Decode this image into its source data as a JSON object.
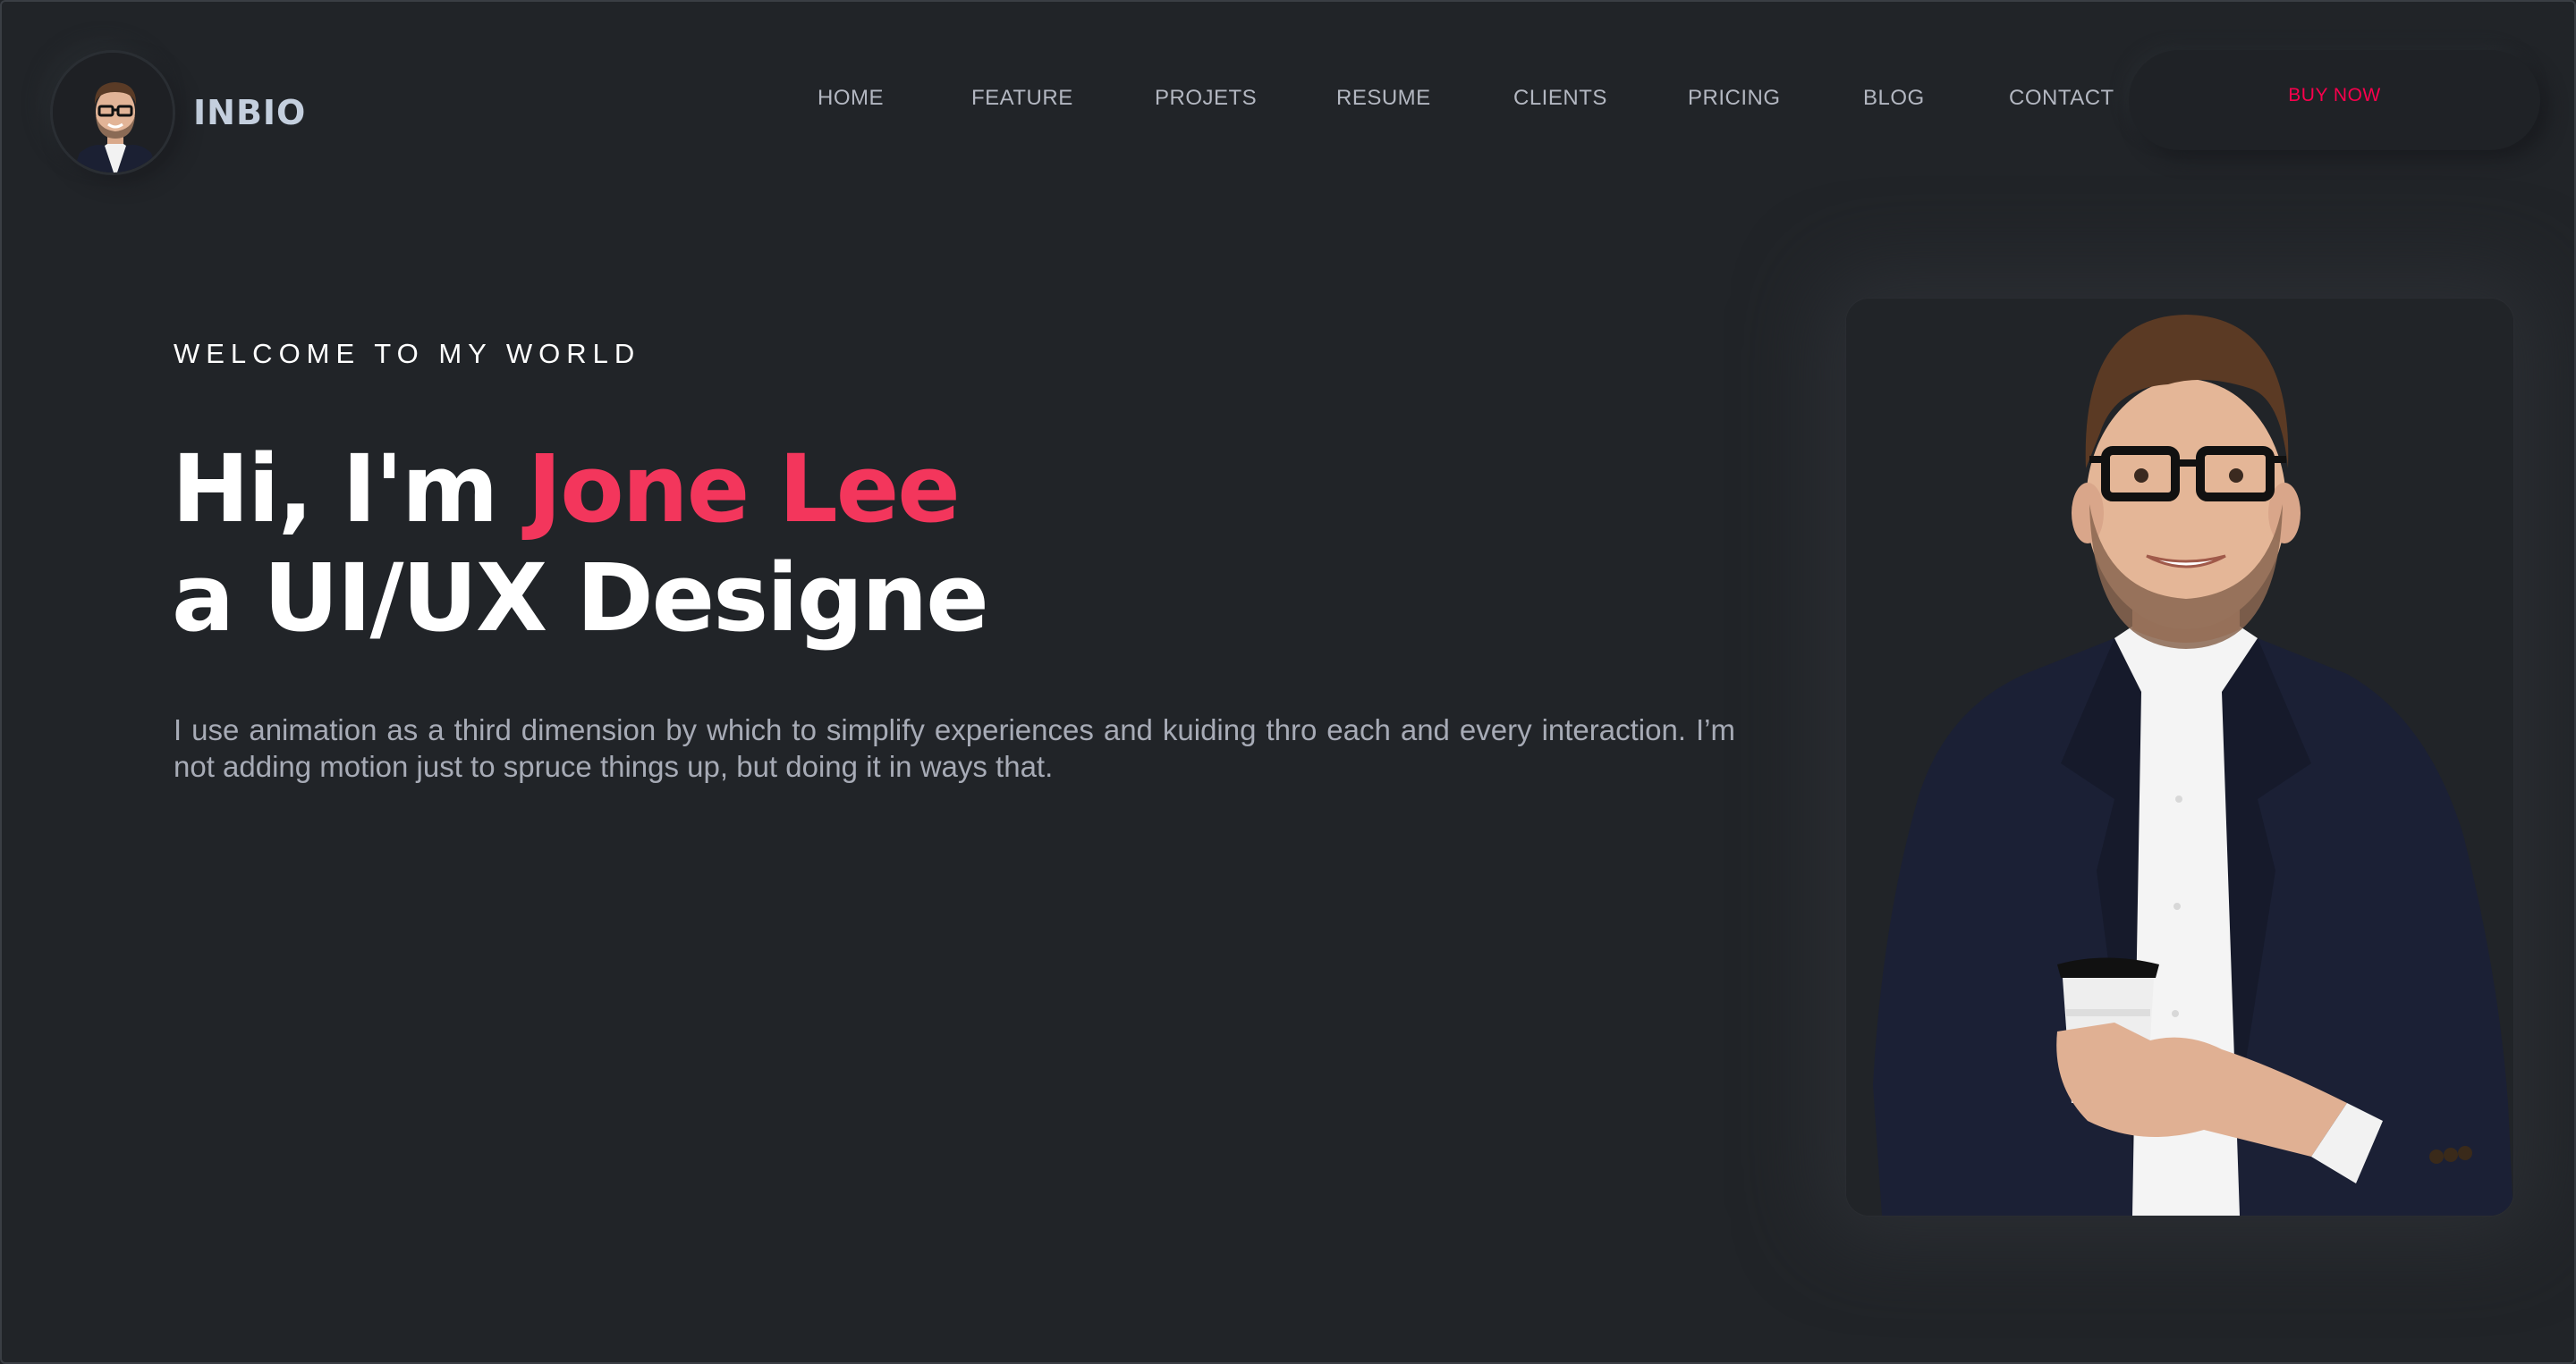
{
  "brand": {
    "name": "INBIO",
    "avatar_icon": "person-avatar-icon"
  },
  "nav": {
    "items": [
      {
        "label": "HOME"
      },
      {
        "label": "FEATURE"
      },
      {
        "label": "PROJETS"
      },
      {
        "label": "RESUME"
      },
      {
        "label": "CLIENTS"
      },
      {
        "label": "PRICING"
      },
      {
        "label": "BLOG"
      },
      {
        "label": "CONTACT"
      }
    ],
    "cta_label": "BUY NOW"
  },
  "hero": {
    "eyebrow": "WELCOME TO MY WORLD",
    "greeting": "Hi, I'm ",
    "name": "Jone Lee",
    "role_line": "a UI/UX Designe",
    "bio": "I use animation as a third dimension by which to simplify experiences and kuiding thro each and every interaction. I’m not adding motion just to spruce things up, but doing it in ways that."
  },
  "colors": {
    "background": "#212428",
    "accent": "#f3365c",
    "cta": "#f9004d",
    "text_primary": "#ffffff",
    "text_muted": "#a7abb6"
  }
}
